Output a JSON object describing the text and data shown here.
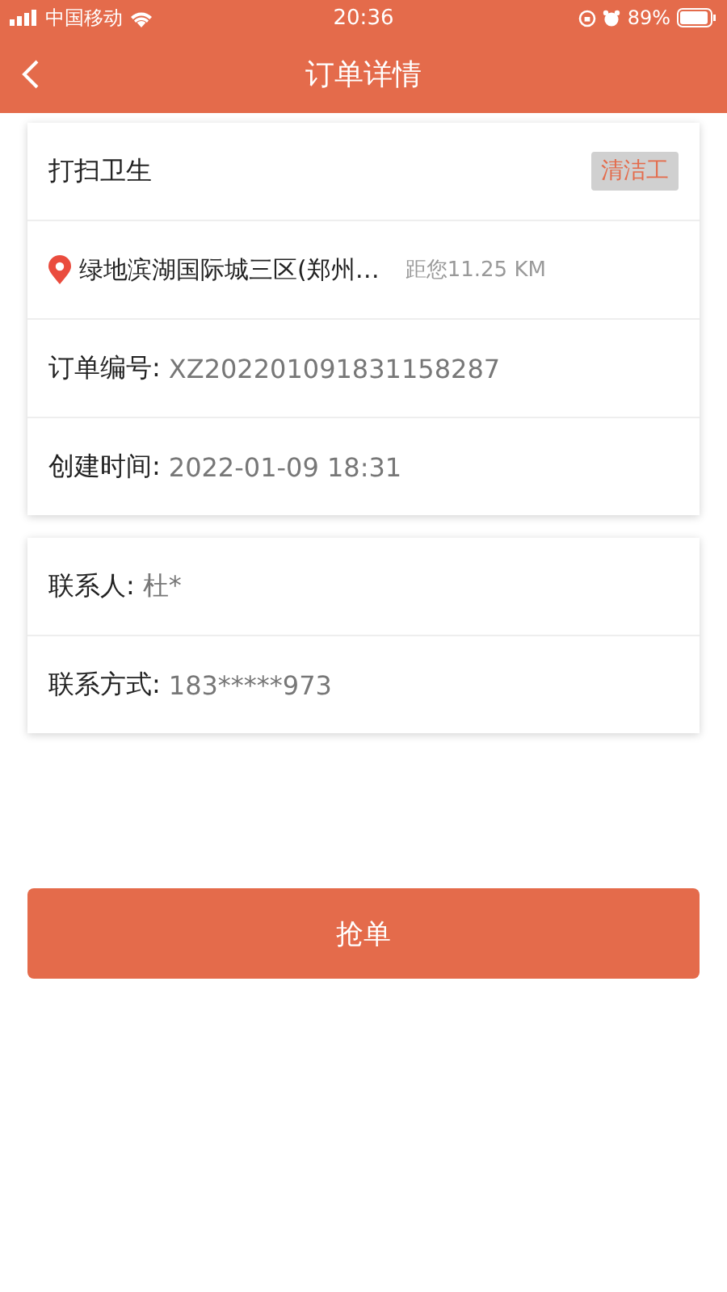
{
  "status_bar": {
    "carrier": "中国移动",
    "time": "20:36",
    "battery": "89%"
  },
  "nav": {
    "title": "订单详情"
  },
  "order": {
    "service": "打扫卫生",
    "tag": "清洁工",
    "address": "绿地滨湖国际城三区(郑州…",
    "distance": "距您11.25 KM",
    "fields": [
      {
        "label": "订单编号:",
        "value": "XZ202201091831158287"
      },
      {
        "label": "创建时间:",
        "value": "2022-01-09 18:31"
      }
    ]
  },
  "contact": [
    {
      "label": "联系人:",
      "value": "杜*"
    },
    {
      "label": "联系方式:",
      "value": "183*****973"
    }
  ],
  "action": "抢单"
}
